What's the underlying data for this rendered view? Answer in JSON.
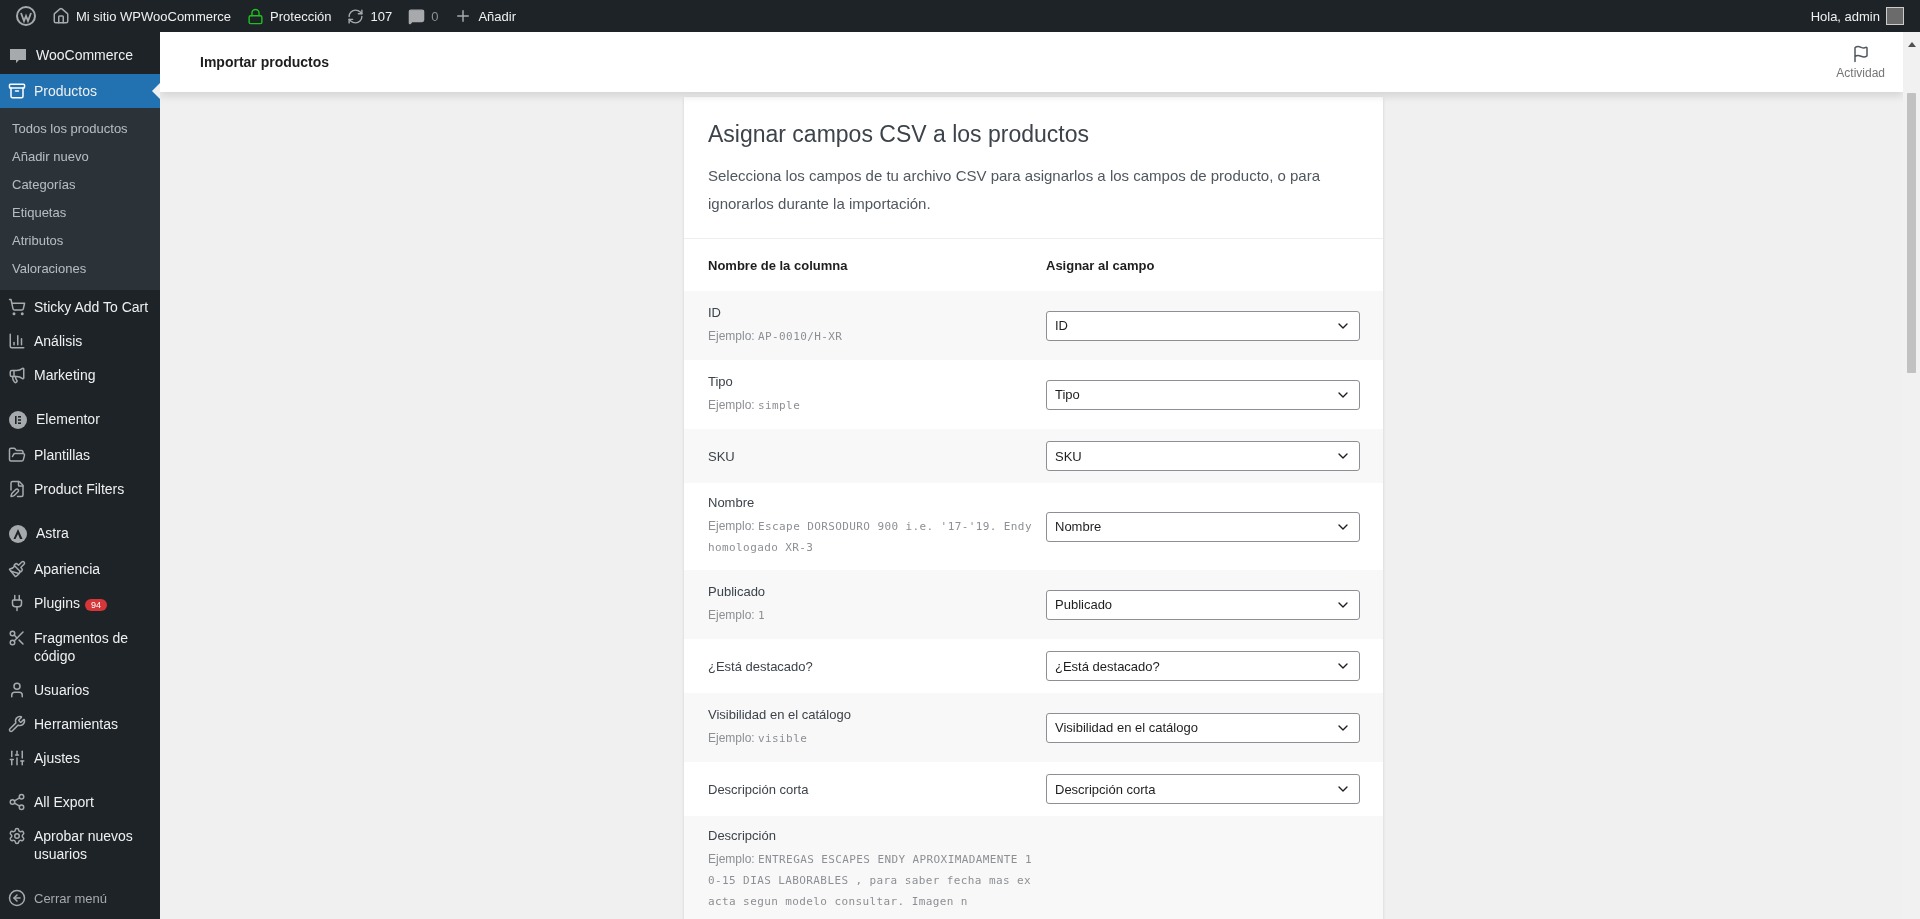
{
  "admin_bar": {
    "site": "Mi sitio WPWooCommerce",
    "security": "Protección",
    "updates": "107",
    "comments": "0",
    "new": "Añadir",
    "greeting": "Hola, admin"
  },
  "sidebar": {
    "sections": [
      {
        "items": [
          {
            "label": "WooCommerce",
            "selected": false
          },
          {
            "label": "Productos",
            "selected": true,
            "submenu": [
              {
                "label": "Todos los productos",
                "selected": false
              },
              {
                "label": "Añadir nuevo",
                "selected": false
              },
              {
                "label": "Categorías",
                "selected": false
              },
              {
                "label": "Etiquetas",
                "selected": false
              },
              {
                "label": "Atributos",
                "selected": false
              },
              {
                "label": "Valoraciones",
                "selected": false
              }
            ]
          },
          {
            "label": "Sticky Add To Cart",
            "selected": false
          },
          {
            "label": "Análisis",
            "selected": false
          },
          {
            "label": "Marketing",
            "selected": false
          }
        ]
      },
      {
        "items": [
          {
            "label": "Elementor",
            "selected": false
          },
          {
            "label": "Plantillas",
            "selected": false
          },
          {
            "label": "Product Filters",
            "selected": false
          }
        ]
      },
      {
        "items": [
          {
            "label": "Astra",
            "selected": false
          },
          {
            "label": "Apariencia",
            "selected": false
          },
          {
            "label": "Plugins",
            "selected": false,
            "badge": "94"
          },
          {
            "label": "Fragmentos de código",
            "selected": false
          },
          {
            "label": "Usuarios",
            "selected": false
          },
          {
            "label": "Herramientas",
            "selected": false
          },
          {
            "label": "Ajustes",
            "selected": false
          }
        ]
      },
      {
        "items": [
          {
            "label": "All Export",
            "selected": false
          },
          {
            "label": "Aprobar nuevos usuarios",
            "selected": false
          }
        ]
      }
    ],
    "collapse": "Cerrar menú"
  },
  "header": {
    "title": "Importar productos",
    "activity": "Actividad"
  },
  "mapping": {
    "title": "Asignar campos CSV a los productos",
    "description": "Selecciona los campos de tu archivo CSV para asignarlos a los campos de producto, o para ignorarlos durante la importación.",
    "columns": [
      "Nombre de la columna",
      "Asignar al campo"
    ],
    "rows": [
      {
        "name": "ID",
        "example_label": "Ejemplo:",
        "example": "AP-0010/H-XR",
        "field": "ID"
      },
      {
        "name": "Tipo",
        "example_label": "Ejemplo:",
        "example": "simple",
        "field": "Tipo"
      },
      {
        "name": "SKU",
        "field": "SKU"
      },
      {
        "name": "Nombre",
        "example_label": "Ejemplo:",
        "example": "Escape DORSODURO 900 i.e. '17-'19. Endy homologado XR-3",
        "field": "Nombre"
      },
      {
        "name": "Publicado",
        "example_label": "Ejemplo:",
        "example": "1",
        "field": "Publicado"
      },
      {
        "name": "¿Está destacado?",
        "field": "¿Está destacado?"
      },
      {
        "name": "Visibilidad en el catálogo",
        "example_label": "Ejemplo:",
        "example": "visible",
        "field": "Visibilidad en el catálogo"
      },
      {
        "name": "Descripción corta",
        "field": "Descripción corta"
      },
      {
        "name": "Descripción",
        "example_label": "Ejemplo:",
        "example": "ENTREGAS ESCAPES ENDY APROXIMADAMENTE 10-15 DIAS LABORABLES , para saber fecha mas exacta segun modelo consultar. Imagen n"
      }
    ]
  }
}
